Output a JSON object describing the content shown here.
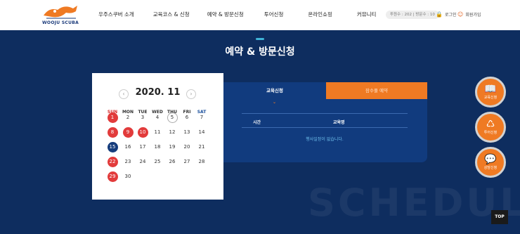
{
  "header": {
    "logo_text": "WOOJU SCUBA",
    "nav": [
      "우주스쿠버 소개",
      "교육코스 & 신청",
      "예약 & 방문신청",
      "투어신청",
      "온라인쇼핑",
      "커뮤니티"
    ],
    "visitor_counter": "투원수 : 202 | 방문수 : 10",
    "login_label": "로그인",
    "signup_label": "회원가입"
  },
  "page": {
    "title": "예약 & 방문신청",
    "background_word": "SCHEDULE"
  },
  "calendar": {
    "month_label": "2020. 11",
    "weekdays": [
      "SUN",
      "MON",
      "TUE",
      "WED",
      "THU",
      "FRI",
      "SAT"
    ],
    "days": [
      {
        "d": "1",
        "style": "red"
      },
      {
        "d": "2"
      },
      {
        "d": "3"
      },
      {
        "d": "4"
      },
      {
        "d": "5",
        "style": "ring"
      },
      {
        "d": "6"
      },
      {
        "d": "7"
      },
      {
        "d": "8",
        "style": "red"
      },
      {
        "d": "9",
        "style": "red"
      },
      {
        "d": "10",
        "style": "red"
      },
      {
        "d": "11"
      },
      {
        "d": "12"
      },
      {
        "d": "13"
      },
      {
        "d": "14"
      },
      {
        "d": "15",
        "style": "navy"
      },
      {
        "d": "16"
      },
      {
        "d": "17"
      },
      {
        "d": "18"
      },
      {
        "d": "19"
      },
      {
        "d": "20"
      },
      {
        "d": "21"
      },
      {
        "d": "22",
        "style": "red"
      },
      {
        "d": "23"
      },
      {
        "d": "24"
      },
      {
        "d": "25"
      },
      {
        "d": "26"
      },
      {
        "d": "27"
      },
      {
        "d": "28"
      },
      {
        "d": "29",
        "style": "red"
      },
      {
        "d": "30"
      }
    ]
  },
  "schedule": {
    "tab_education": "교육신청",
    "tab_booking": "잠수풀 예약",
    "col_time": "시간",
    "col_name": "교육명",
    "empty_message": "행사일정이 없습니다."
  },
  "side_buttons": [
    {
      "label": "교육신청",
      "icon": "book-icon"
    },
    {
      "label": "투어신청",
      "icon": "diver-icon"
    },
    {
      "label": "상담신청",
      "icon": "chat-icon"
    }
  ],
  "top_button": "TOP",
  "colors": {
    "accent": "#ef7a23",
    "navy": "#0e2d5f",
    "holiday": "#e23b3b"
  }
}
